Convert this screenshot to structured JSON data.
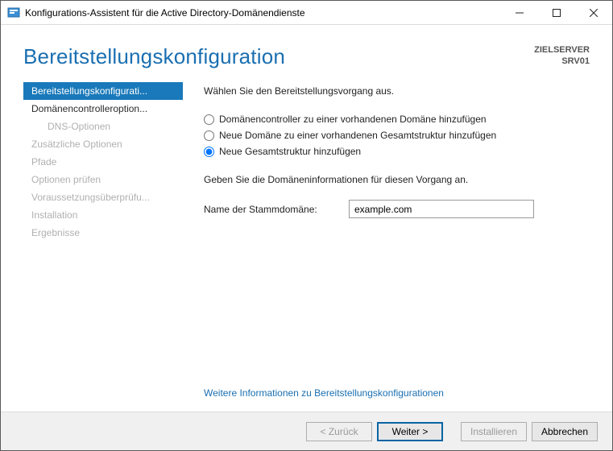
{
  "window": {
    "title": "Konfigurations-Assistent für die Active Directory-Domänendienste"
  },
  "header": {
    "title": "Bereitstellungskonfiguration",
    "target_label": "ZIELSERVER",
    "target_name": "SRV01"
  },
  "sidebar": {
    "items": [
      {
        "label": "Bereitstellungskonfigurati...",
        "state": "selected"
      },
      {
        "label": "Domänencontrolleroption...",
        "state": "enabled"
      },
      {
        "label": "DNS-Optionen",
        "state": "disabled",
        "sub": true
      },
      {
        "label": "Zusätzliche Optionen",
        "state": "disabled"
      },
      {
        "label": "Pfade",
        "state": "disabled"
      },
      {
        "label": "Optionen prüfen",
        "state": "disabled"
      },
      {
        "label": "Voraussetzungsüberprüfu...",
        "state": "disabled"
      },
      {
        "label": "Installation",
        "state": "disabled"
      },
      {
        "label": "Ergebnisse",
        "state": "disabled"
      }
    ]
  },
  "content": {
    "select_op": "Wählen Sie den Bereitstellungsvorgang aus.",
    "radios": [
      {
        "label": "Domänencontroller zu einer vorhandenen Domäne hinzufügen",
        "checked": false
      },
      {
        "label": "Neue Domäne zu einer vorhandenen Gesamtstruktur hinzufügen",
        "checked": false
      },
      {
        "label": "Neue Gesamtstruktur hinzufügen",
        "checked": true
      }
    ],
    "domain_info": "Geben Sie die Domäneninformationen für diesen Vorgang an.",
    "root_domain_label": "Name der Stammdomäne:",
    "root_domain_value": "example.com",
    "more_link": "Weitere Informationen zu Bereitstellungskonfigurationen"
  },
  "footer": {
    "back": "< Zurück",
    "next": "Weiter >",
    "install": "Installieren",
    "cancel": "Abbrechen"
  }
}
